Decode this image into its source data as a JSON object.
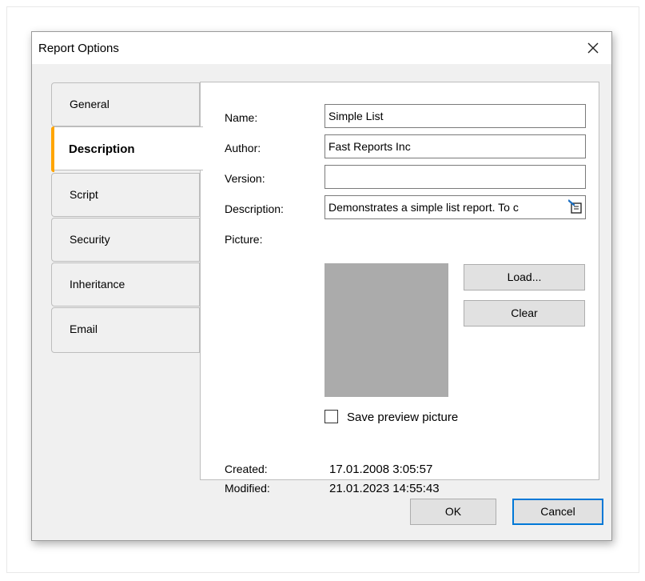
{
  "dialog": {
    "title": "Report Options",
    "close_icon": "close-icon"
  },
  "tabs": [
    {
      "label": "General",
      "active": false
    },
    {
      "label": "Description",
      "active": true
    },
    {
      "label": "Script",
      "active": false
    },
    {
      "label": "Security",
      "active": false
    },
    {
      "label": "Inheritance",
      "active": false
    },
    {
      "label": "Email",
      "active": false
    }
  ],
  "form": {
    "name_label": "Name:",
    "name_value": "Simple List",
    "author_label": "Author:",
    "author_value": "Fast Reports Inc",
    "version_label": "Version:",
    "version_value": "",
    "description_label": "Description:",
    "description_value": "Demonstrates a simple list report. To c",
    "picture_label": "Picture:",
    "load_button": "Load...",
    "clear_button": "Clear",
    "save_preview_label": "Save preview picture",
    "save_preview_checked": false,
    "created_label": "Created:",
    "created_value": "17.01.2008 3:05:57",
    "modified_label": "Modified:",
    "modified_value": "21.01.2023 14:55:43"
  },
  "footer": {
    "ok_button": "OK",
    "cancel_button": "Cancel"
  },
  "colors": {
    "accent": "#ffa500",
    "picture_placeholder": "#ababab",
    "default_button_border": "#0078d7"
  }
}
